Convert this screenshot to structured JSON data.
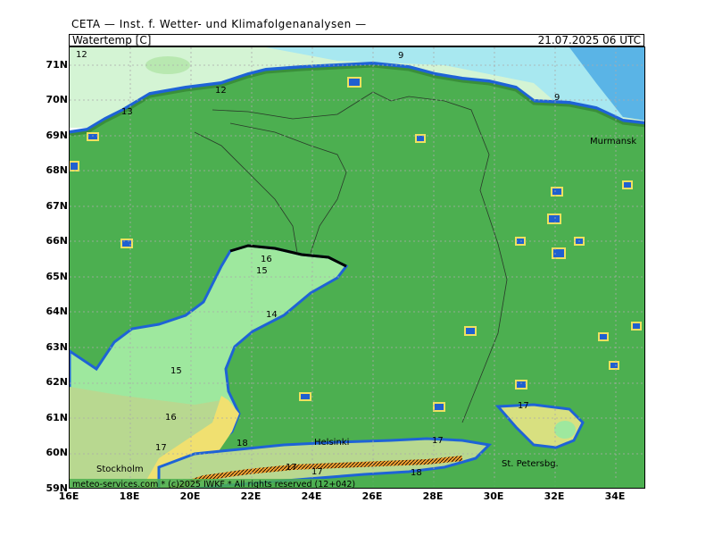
{
  "header": {
    "agency": "CETA — Inst. f. Wetter- und Klimafolgenanalysen —",
    "parameter": "Watertemp [C]",
    "valid_time": "21.07.2025 06 UTC"
  },
  "axes": {
    "lat_labels": [
      "71N",
      "70N",
      "69N",
      "68N",
      "67N",
      "66N",
      "65N",
      "64N",
      "63N",
      "62N",
      "61N",
      "60N",
      "59N"
    ],
    "lon_labels": [
      "16E",
      "18E",
      "20E",
      "22E",
      "24E",
      "26E",
      "28E",
      "30E",
      "32E",
      "34E"
    ]
  },
  "places": {
    "murmansk": "Murmansk",
    "helsinki": "Helsinki",
    "stockholm": "Stockholm",
    "st_petersburg": "St. Petersbg."
  },
  "isotherm_labels": {
    "l12a": "12",
    "l9a": "9",
    "l12b": "12",
    "l13": "13",
    "l9b": "9",
    "l16a": "16",
    "l15a": "15",
    "l14": "14",
    "l15b": "15",
    "l16b": "16",
    "l17a": "17",
    "l18a": "18",
    "l17b": "17",
    "l17c": "17",
    "l17d": "17",
    "l18b": "18",
    "l17e": "17"
  },
  "footer": {
    "copyright": "meteo-services.com * (c)2025 IWKF * All rights reserved (12+042)"
  },
  "colors": {
    "land": "#4caf50",
    "ocean_warm": "#d4f4d4",
    "ocean_cool": "#a8e8f0",
    "ocean_cold": "#5ab4e6",
    "coast_blue": "#1e63d6",
    "coast_yellow": "#f0e060",
    "coast_orange": "#f0a030",
    "baltic_15": "#9ee89e",
    "baltic_16": "#b8d890",
    "baltic_17": "#d8e080",
    "baltic_18": "#f0e070"
  }
}
